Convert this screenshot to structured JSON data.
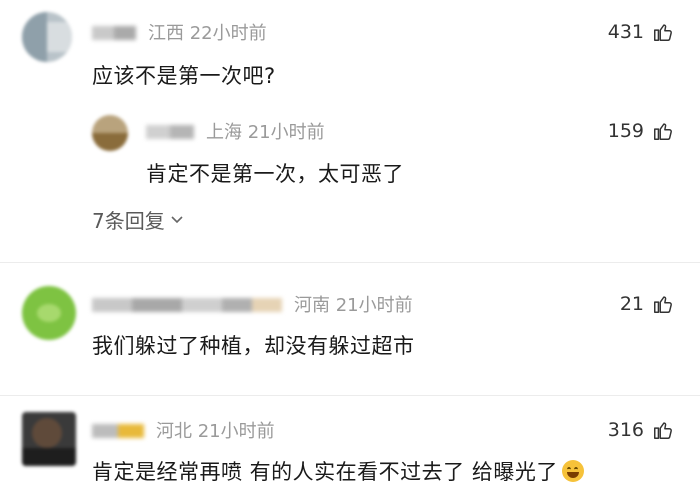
{
  "comments": [
    {
      "location_time": "江西 22小时前",
      "likes": "431",
      "text": "应该不是第一次吧?"
    },
    {
      "location_time": "上海 21小时前",
      "likes": "159",
      "text": "肯定不是第一次，太可恶了"
    },
    {
      "location_time": "河南 21小时前",
      "likes": "21",
      "text": "我们躲过了种植，却没有躲过超市"
    },
    {
      "location_time": "河北 21小时前",
      "likes": "316",
      "text": "肯定是经常再喷 有的人实在看不过去了 给曝光了"
    }
  ],
  "replies_link": "7条回复",
  "icons": {
    "like": "thumbs-up-icon",
    "expand": "chevron-down-icon",
    "laugh": "laughing-tears-emoji-icon"
  },
  "colors": {
    "meta_text": "#9a9a9a",
    "body_text": "#1a1a1a",
    "divider": "#ececec"
  }
}
